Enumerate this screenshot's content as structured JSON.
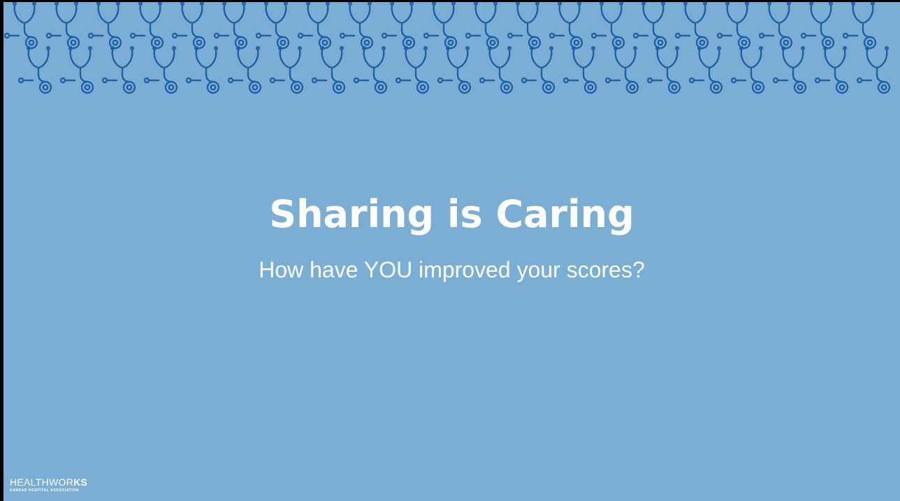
{
  "slide": {
    "title": "Sharing is Caring",
    "subtitle": "How have YOU improved your scores?"
  },
  "logo": {
    "text_regular": "HEALTHWOR",
    "text_bold": "KS",
    "tagline": "KANSAS HOSPITAL ASSOCIATION"
  },
  "decoration": {
    "pattern_icon": "stethoscope-icon",
    "pattern_color": "#1f5fa8",
    "background_color": "#7aaed4"
  }
}
